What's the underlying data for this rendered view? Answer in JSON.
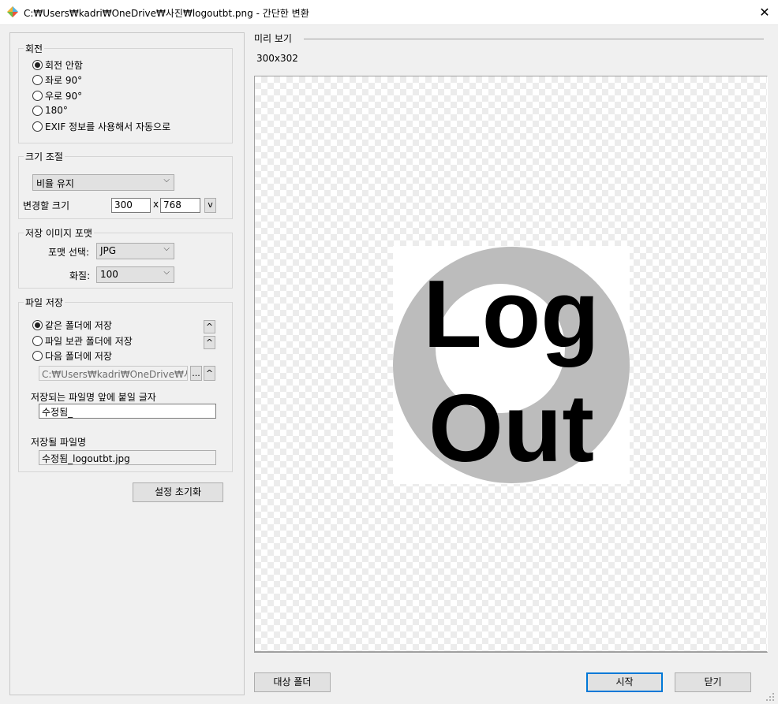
{
  "window": {
    "title": "C:₩Users₩kadri₩OneDrive₩사진₩logoutbt.png - 간단한 변환",
    "close_symbol": "✕"
  },
  "rotation": {
    "legend": "회전",
    "options": [
      "회전 안함",
      "좌로 90°",
      "우로 90°",
      "180°",
      "EXIF 정보를 사용해서 자동으로"
    ],
    "selected_index": 0
  },
  "resize": {
    "legend": "크기 조절",
    "mode": "비율 유지",
    "size_label": "변경할 크기",
    "width": "300",
    "x_sep": "x",
    "height": "768",
    "toggle_label": "v"
  },
  "format": {
    "legend": "저장 이미지 포맷",
    "format_label": "포맷 선택:",
    "format_value": "JPG",
    "quality_label": "화질:",
    "quality_value": "100"
  },
  "save": {
    "legend": "파일 저장",
    "options": [
      "같은 폴더에 저장",
      "파일 보관 폴더에 저장",
      "다음 폴더에 저장"
    ],
    "selected_index": 0,
    "up_label": "^",
    "folder_path": "C:₩Users₩kadri₩OneDrive₩사진₩",
    "browse_label": "...",
    "prefix_label": "저장되는 파일명 앞에 붙일 글자",
    "prefix_value": "수정됨_",
    "filename_label": "저장될 파일명",
    "filename_value": "수정됨_logoutbt.jpg"
  },
  "buttons": {
    "reset": "설정 초기화",
    "target_folder": "대상 폴더",
    "start": "시작",
    "close": "닫기"
  },
  "preview": {
    "label": "미리 보기",
    "dimensions": "300x302",
    "image_line1": "Log",
    "image_line2": "Out"
  },
  "colors": {
    "ring": "#bcbcbc",
    "accent_border": "#0078d7"
  }
}
